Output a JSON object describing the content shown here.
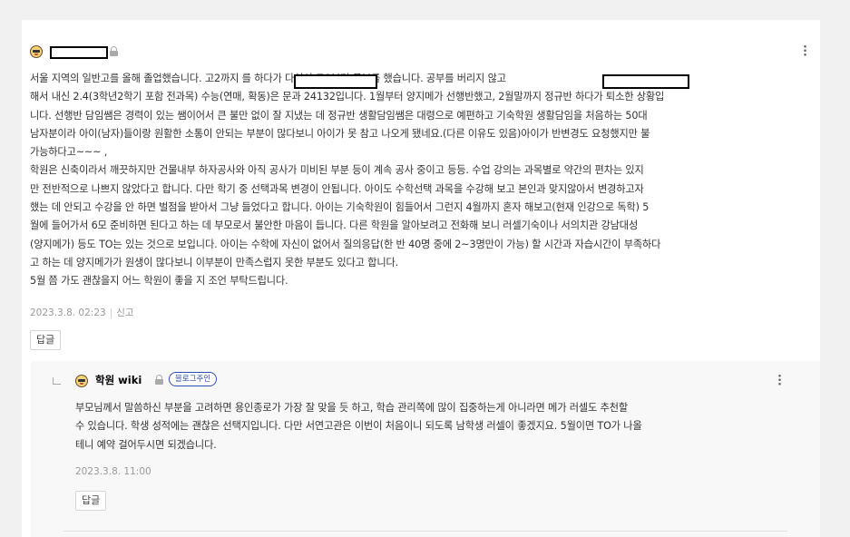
{
  "comment": {
    "author_redacted": true,
    "icons": {
      "avatar": "emoji-face-icon",
      "lock": "lock-icon",
      "more": "more-vertical-icon"
    },
    "body": [
      "서울 지역의 일반고를 올해 졸업했습니다. 고2까지                           를 하다가 다쳐서 고3부터 공부를 했습니다.                           공부를 버리지 않고",
      "해서 내신 2.4(3학년2학기 포함 전과목) 수능(연매, 확동)은 문과 24132입니다. 1월부터 양지메가 선행반했고, 2월말까지 정규반 하다가 퇴소한 상황입",
      "니다. 선행반 담임쌤은 경력이 있는 쌤이어서 큰 불만 없이 잘 지냈는 데 정규반 생활담임쌤은 대령으로 예편하고 기숙학원 생활담임을 처음하는 50대",
      "남자분이라 아이(남자)들이랑 원활한 소통이 안되는 부분이 많다보니 아이가 못 참고 나오게 됐네요.(다른 이유도 있음)아이가 반변경도 요청했지만 불",
      "가능하다고~~~ ,",
      "학원은 신축이라서 깨끗하지만 건물내부 하자공사와 아직 공사가 미비된 부분 등이 계속 공사 중이고 등등. 수업 강의는 과목별로 약간의 편차는 있지",
      "만 전반적으로 나쁘지 않았다고 합니다. 다만 학기 중 선택과목 변경이 안됩니다. 아이도 수학선택 과목을 수강해 보고 본인과 맞지않아서 변경하고자",
      "했는 데 안되고 수강을 안 하면 벌점을 받아서 그냥 들었다고 합니다. 아이는 기숙학원이 힘들어서 그런지 4월까지 혼자 해보고(현재 인강으로 독학) 5",
      "월에 들어가서 6모 준비하면 된다고 하는 데 부모로서 불안한 마음이 듭니다. 다른 학원을 알아보려고 전화해 보니 러셀기숙이나 서의치관 강남대성",
      "(양지메가) 등도 TO는 있는 것으로 보입니다. 아이는 수학에 자신이 없어서 질의응답(한 반 40명 중에 2~3명만이 가능) 할 시간과 자습시간이 부족하다",
      "고 하는 데 양지메가가 원생이 많다보니 이부분이 만족스럽지 못한 부분도 있다고 합니다.",
      "5월 쯤 가도 괜찮을지 어느 학원이 좋을 지 조언 부탁드립니다."
    ],
    "date": "2023.3.8. 02:23",
    "separator": "|",
    "report_label": "신고",
    "reply_label": "답글"
  },
  "reply": {
    "author": "학원 wiki",
    "badge": "블로그주인",
    "icons": {
      "reply_arrow": "reply-arrow-icon",
      "avatar": "emoji-face-icon",
      "lock": "lock-icon",
      "more": "more-vertical-icon"
    },
    "body": [
      "부모님께서 말씀하신 부분을 고려하면 용인종로가 가장 잘 맞을 듯 하고, 학습 관리쪽에 많이 집중하는게 아니라면 메가 러셀도 추천할",
      "수 있습니다. 학생 성적에는 괜찮은 선택지입니다. 다만 서연고관은 이번이 처음이니 되도록 남학생 러셀이 좋겠지요. 5월이면 TO가 나올",
      "테니 예약 걸어두시면 되겠습니다."
    ],
    "date": "2023.3.8. 11:00",
    "reply_label": "답글"
  },
  "colors": {
    "badge": "#2e4eb3",
    "background": "#f1f1f1",
    "panel": "#ffffff",
    "reply_bg": "#f8f8f8"
  }
}
